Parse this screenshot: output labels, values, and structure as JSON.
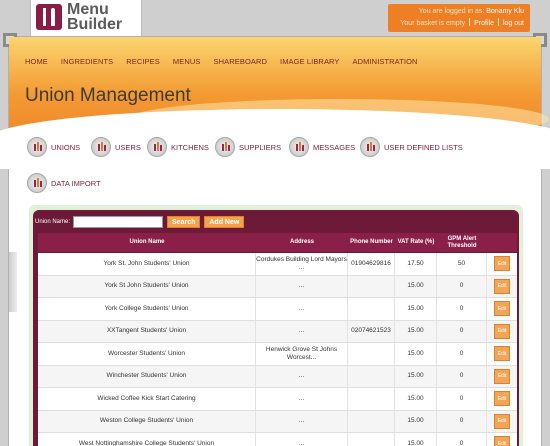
{
  "logo": {
    "line1": "Menu",
    "line2": "Builder"
  },
  "user": {
    "logged_prefix": "You are logged in as:",
    "name": "Bonamy Klu",
    "basket": "Your basket is empty",
    "profile": "Profile",
    "logout": "log out"
  },
  "nav": [
    "HOME",
    "INGREDIENTS",
    "RECIPES",
    "MENUS",
    "SHAREBOARD",
    "IMAGE LIBRARY",
    "ADMINISTRATION"
  ],
  "page_title": "Union Management",
  "icon_links": [
    "UNIONS",
    "USERS",
    "KITCHENS",
    "SUPPLIERS",
    "MESSAGES",
    "USER DEFINED LISTS",
    "DATA IMPORT"
  ],
  "search": {
    "label": "Union Name:",
    "value": "",
    "search_btn": "Search",
    "add_btn": "Add New"
  },
  "table": {
    "columns": [
      "Union Name",
      "Address",
      "Phone Number",
      "VAT Rate (%)",
      "GPM Alert Threshold",
      ""
    ],
    "edit_label": "Edit",
    "rows": [
      {
        "name": "York St. John Students' Union",
        "address": "Cordukes Building Lord Mayors ...",
        "phone": "01904629816",
        "vat": "17.50",
        "gpm": "50"
      },
      {
        "name": "York St John Students' Union",
        "address": "...",
        "phone": "",
        "vat": "15.00",
        "gpm": "0"
      },
      {
        "name": "York College Students' Union",
        "address": "...",
        "phone": "",
        "vat": "15.00",
        "gpm": "0"
      },
      {
        "name": "XXTangent Students' Union",
        "address": "...",
        "phone": "02074621523",
        "vat": "15.00",
        "gpm": "0"
      },
      {
        "name": "Worcester Students' Union",
        "address": "Henwick Grove St Johns Worcest...",
        "phone": "",
        "vat": "15.00",
        "gpm": "0"
      },
      {
        "name": "Winchester Students' Union",
        "address": "...",
        "phone": "",
        "vat": "15.00",
        "gpm": "0"
      },
      {
        "name": "Wicked Coffee Kick Start Catering",
        "address": "...",
        "phone": "",
        "vat": "15.00",
        "gpm": "0"
      },
      {
        "name": "Weston College Students' Union",
        "address": "...",
        "phone": "",
        "vat": "15.00",
        "gpm": "0"
      },
      {
        "name": "West Nottinghamshire College Students' Union",
        "address": "...",
        "phone": "",
        "vat": "15.00",
        "gpm": "0"
      }
    ]
  }
}
